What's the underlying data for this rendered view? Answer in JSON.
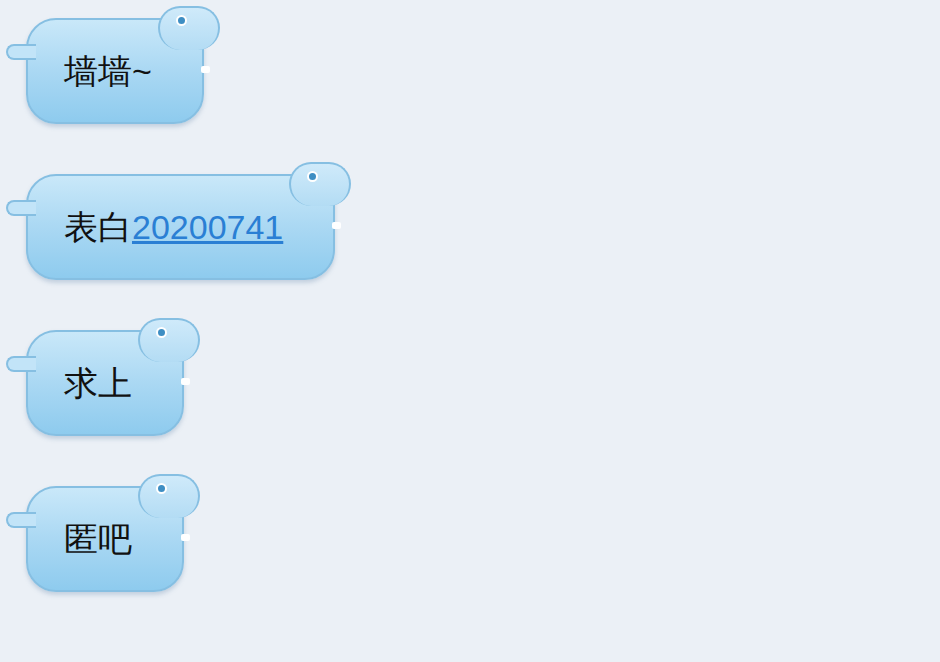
{
  "messages": [
    {
      "segments": [
        {
          "text": "墙墙~",
          "kind": "text"
        }
      ]
    },
    {
      "segments": [
        {
          "text": "表白",
          "kind": "text"
        },
        {
          "text": "20200741",
          "kind": "link"
        }
      ]
    },
    {
      "segments": [
        {
          "text": "求上",
          "kind": "text"
        }
      ]
    },
    {
      "segments": [
        {
          "text": "匿吧",
          "kind": "text"
        }
      ]
    }
  ]
}
